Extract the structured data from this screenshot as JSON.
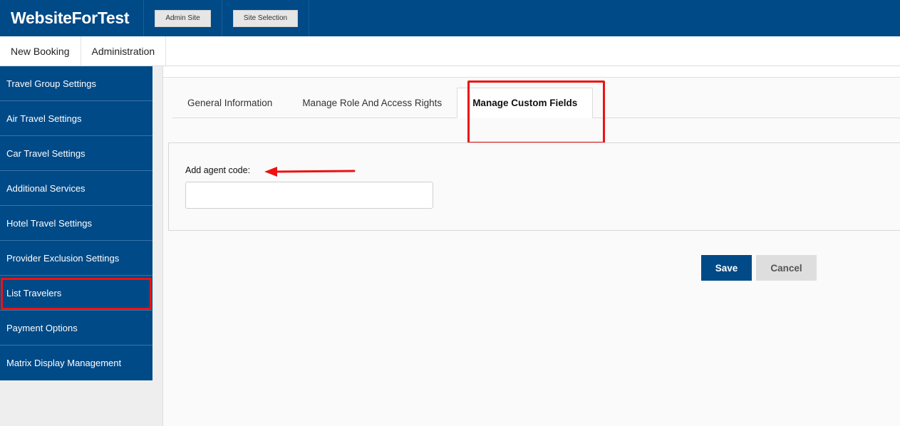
{
  "header": {
    "brand": "WebsiteForTest",
    "buttons": [
      {
        "label": "Admin Site"
      },
      {
        "label": "Site Selection"
      }
    ]
  },
  "topnav": {
    "items": [
      {
        "label": "New Booking"
      },
      {
        "label": "Administration"
      }
    ]
  },
  "sidebar": {
    "items": [
      {
        "label": "Travel Group Settings"
      },
      {
        "label": "Air Travel Settings"
      },
      {
        "label": "Car Travel Settings"
      },
      {
        "label": "Additional Services"
      },
      {
        "label": "Hotel Travel Settings"
      },
      {
        "label": "Provider Exclusion Settings"
      },
      {
        "label": "List Travelers"
      },
      {
        "label": "Payment Options"
      },
      {
        "label": "Matrix Display Management"
      }
    ]
  },
  "main": {
    "tabs": [
      {
        "label": "General Information",
        "active": false
      },
      {
        "label": "Manage Role And Access Rights",
        "active": false
      },
      {
        "label": "Manage Custom Fields",
        "active": true
      }
    ],
    "form": {
      "agent_code_label": "Add agent code:",
      "agent_code_value": "",
      "agent_code_placeholder": ""
    },
    "actions": {
      "save_label": "Save",
      "cancel_label": "Cancel"
    }
  },
  "colors": {
    "brand_blue": "#004a87",
    "annotation_red": "#ee1111"
  }
}
